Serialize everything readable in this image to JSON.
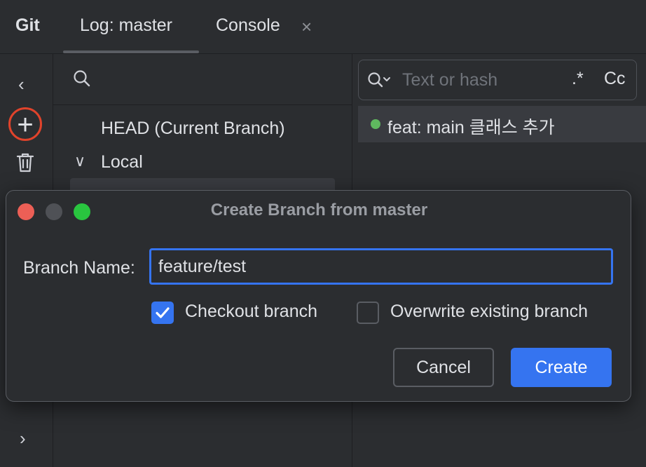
{
  "tool_window": {
    "title": "Git",
    "tabs": [
      {
        "label": "Log: master"
      },
      {
        "label": "Console"
      }
    ],
    "tab_close_glyph": "×"
  },
  "left_toolbar": {
    "collapse_glyph": "‹",
    "add_glyph": "+",
    "expand_glyph": "›"
  },
  "branches_panel": {
    "head_label": "HEAD (Current Branch)",
    "local_label": "Local",
    "local_chevron": "∨"
  },
  "commits_panel": {
    "search_placeholder": "Text or hash",
    "regex_toggle": ".*",
    "case_toggle": "Cc",
    "commit_message": "feat: main 클래스 추가",
    "commit_dot_color": "#5fb85f"
  },
  "dialog": {
    "title": "Create Branch from master",
    "branch_name_label": "Branch Name:",
    "branch_name_value": "feature/test",
    "checkout_label": "Checkout branch",
    "checkout_checked": true,
    "overwrite_label": "Overwrite existing branch",
    "overwrite_checked": false,
    "cancel_label": "Cancel",
    "create_label": "Create",
    "accent_color": "#3574f0"
  }
}
